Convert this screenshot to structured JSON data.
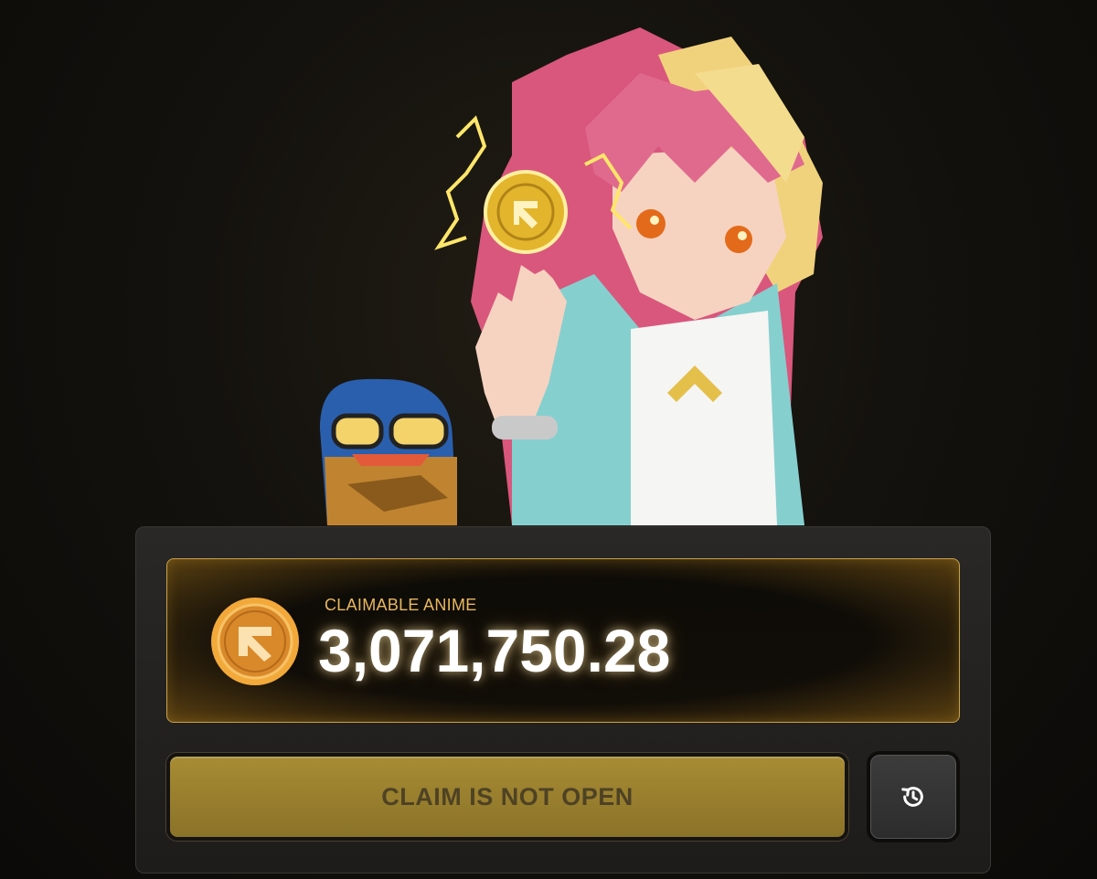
{
  "balance": {
    "label": "CLAIMABLE ANIME",
    "amount": "3,071,750.28"
  },
  "claim_button": {
    "label": "CLAIM IS NOT OPEN",
    "enabled": false
  },
  "icons": {
    "coin": "anime-coin-icon",
    "history": "history-icon"
  },
  "colors": {
    "accent_gold": "#e9b75e",
    "border_gold": "#c9a24a",
    "button_disabled": "#9a7f2e",
    "button_text": "#4e4224"
  }
}
